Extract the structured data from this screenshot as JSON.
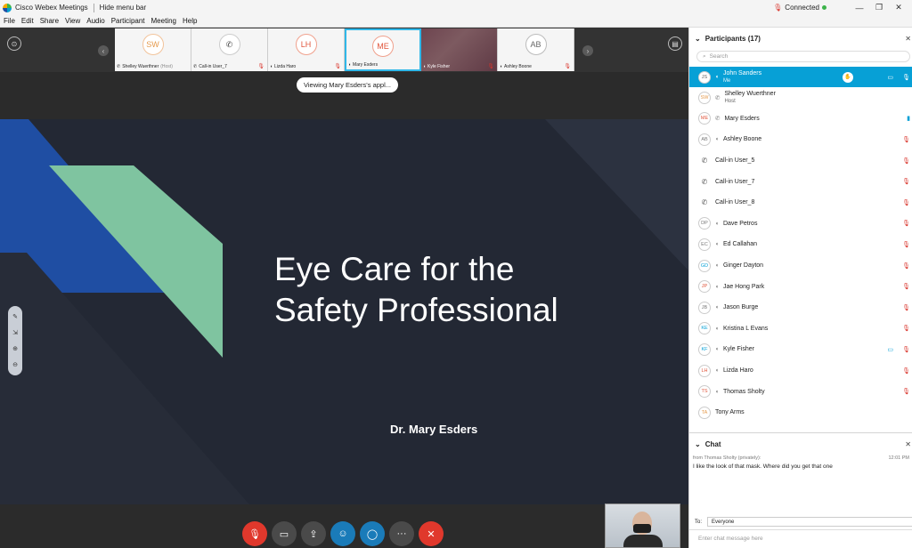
{
  "titlebar": {
    "app_title": "Cisco Webex Meetings",
    "hide_menu": "Hide menu bar",
    "status": "Connected"
  },
  "menu": [
    "File",
    "Edit",
    "Share",
    "View",
    "Audio",
    "Participant",
    "Meeting",
    "Help"
  ],
  "thumbnails": [
    {
      "initials": "SW",
      "name": "Shelley Wuerthner",
      "tag": "(Host)",
      "type": "avatar"
    },
    {
      "initials": "",
      "name": "Call-in User_7",
      "tag": "",
      "type": "phone"
    },
    {
      "initials": "LH",
      "name": "Lizda Haro",
      "tag": "",
      "type": "avatar"
    },
    {
      "initials": "ME",
      "name": "Mary Esders",
      "tag": "",
      "type": "avatar"
    },
    {
      "initials": "",
      "name": "Kyle Fisher",
      "tag": "",
      "type": "video"
    },
    {
      "initials": "AB",
      "name": "Ashley Boone",
      "tag": "",
      "type": "avatar"
    }
  ],
  "viewing_pill": "Viewing Mary Esders's appl...",
  "slide": {
    "title_line1": "Eye Care for the",
    "title_line2": "Safety Professional",
    "subtitle": "Dr. Mary Esders"
  },
  "participants": {
    "header": "Participants (17)",
    "search_placeholder": "Search",
    "list": [
      {
        "initials": "JS",
        "name": "John Sanders",
        "role": "Me"
      },
      {
        "initials": "SW",
        "name": "Shelley Wuerthner",
        "role": "Host"
      },
      {
        "initials": "ME",
        "name": "Mary Esders",
        "role": ""
      },
      {
        "initials": "AB",
        "name": "Ashley Boone",
        "role": ""
      },
      {
        "initials": "",
        "name": "Call-in User_5",
        "role": ""
      },
      {
        "initials": "",
        "name": "Call-in User_7",
        "role": ""
      },
      {
        "initials": "",
        "name": "Call-in User_8",
        "role": ""
      },
      {
        "initials": "DP",
        "name": "Dave Petros",
        "role": ""
      },
      {
        "initials": "EC",
        "name": "Ed Callahan",
        "role": ""
      },
      {
        "initials": "GD",
        "name": "Ginger Dayton",
        "role": ""
      },
      {
        "initials": "JP",
        "name": "Jae Hong Park",
        "role": ""
      },
      {
        "initials": "JB",
        "name": "Jason Burge",
        "role": ""
      },
      {
        "initials": "KE",
        "name": "Kristina L Evans",
        "role": ""
      },
      {
        "initials": "KF",
        "name": "Kyle Fisher",
        "role": ""
      },
      {
        "initials": "LH",
        "name": "Lizda Haro",
        "role": ""
      },
      {
        "initials": "TS",
        "name": "Thomas Sholty",
        "role": ""
      },
      {
        "initials": "TA",
        "name": "Tony Arms",
        "role": ""
      }
    ]
  },
  "chat": {
    "header": "Chat",
    "from": "from Thomas Sholty (privately):",
    "time": "12:01 PM",
    "message": "I like the look of that mask.  Where did you get that one",
    "to_label": "To:",
    "to_value": "Everyone",
    "input_placeholder": "Enter chat message here"
  },
  "colors": {
    "accent": "#07a0d6",
    "danger": "#e0382c",
    "slide_bg": "#232834",
    "slide_blue": "#1f4ea3",
    "slide_green": "#7fc4a0"
  }
}
